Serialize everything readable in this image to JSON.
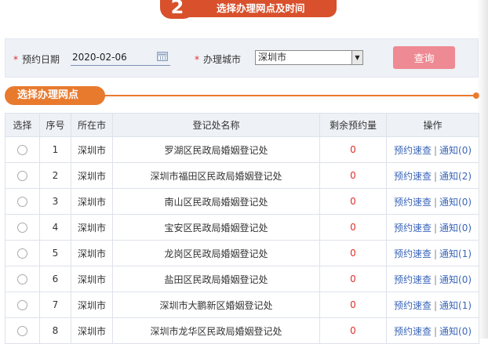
{
  "step": {
    "number": "2",
    "title": "选择办理网点及时间"
  },
  "query": {
    "date_label": "预约日期",
    "date_value": "2020-02-06",
    "city_label": "办理城市",
    "city_value": "深圳市",
    "button_label": "查询"
  },
  "section_title": "选择办理网点",
  "table": {
    "headers": [
      "选择",
      "序号",
      "所在市",
      "登记处名称",
      "剩余预约量",
      "操作"
    ],
    "rows": [
      {
        "index": "1",
        "city": "深圳市",
        "name": "罗湖区民政局婚姻登记处",
        "remaining": "0",
        "action_book": "预约速查",
        "action_notice": "通知(0)"
      },
      {
        "index": "2",
        "city": "深圳市",
        "name": "深圳市福田区民政局婚姻登记处",
        "remaining": "0",
        "action_book": "预约速查",
        "action_notice": "通知(2)"
      },
      {
        "index": "3",
        "city": "深圳市",
        "name": "南山区民政局婚姻登记处",
        "remaining": "0",
        "action_book": "预约速查",
        "action_notice": "通知(0)"
      },
      {
        "index": "4",
        "city": "深圳市",
        "name": "宝安区民政局婚姻登记处",
        "remaining": "0",
        "action_book": "预约速查",
        "action_notice": "通知(0)"
      },
      {
        "index": "5",
        "city": "深圳市",
        "name": "龙岗区民政局婚姻登记处",
        "remaining": "0",
        "action_book": "预约速查",
        "action_notice": "通知(1)"
      },
      {
        "index": "6",
        "city": "深圳市",
        "name": "盐田区民政局婚姻登记处",
        "remaining": "0",
        "action_book": "预约速查",
        "action_notice": "通知(0)"
      },
      {
        "index": "7",
        "city": "深圳市",
        "name": "深圳市大鹏新区婚姻登记处",
        "remaining": "0",
        "action_book": "预约速查",
        "action_notice": "通知(1)"
      },
      {
        "index": "8",
        "city": "深圳市",
        "name": "深圳市龙华区民政局婚姻登记处",
        "remaining": "0",
        "action_book": "预约速查",
        "action_notice": "通知(0)"
      }
    ]
  },
  "colors": {
    "accent": "#d8502c",
    "section": "#e87a2e",
    "button": "#ee8a93",
    "link": "#3b66b8",
    "count": "#e0302a"
  }
}
